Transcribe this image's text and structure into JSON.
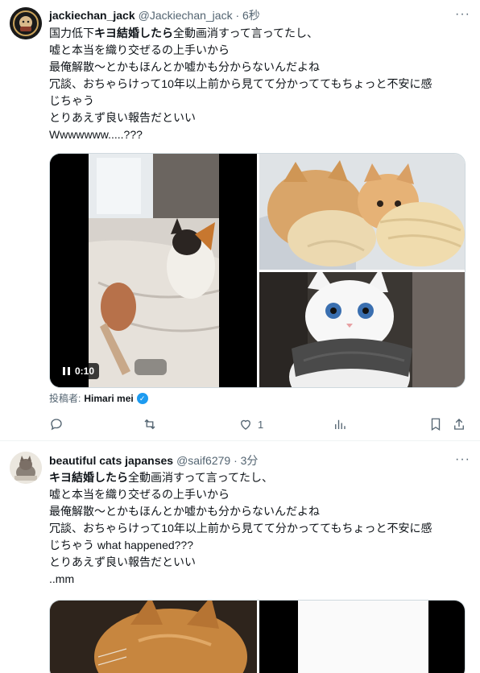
{
  "tweets": [
    {
      "name": "jackiechan_jack",
      "handle": "@Jackiechan_jack · 6秒",
      "more": "···",
      "lines": [
        {
          "pre": "国力低下",
          "bold": "キヨ結婚したら",
          "post": "全動画消すって言ってたし、"
        },
        {
          "pre": "嘘と本当を織り交ぜるの上手いから",
          "bold": "",
          "post": ""
        },
        {
          "pre": "最俺解散〜とかもほんとか嘘かも分からないんだよね",
          "bold": "",
          "post": ""
        },
        {
          "pre": "冗談、おちゃらけって10年以上前から見てて分かっててもちょっと不安に感",
          "bold": "",
          "post": ""
        },
        {
          "pre": "じちゃう",
          "bold": "",
          "post": ""
        },
        {
          "pre": "とりあえず良い報告だといい",
          "bold": "",
          "post": ""
        },
        {
          "pre": "Wwwwwww.....???",
          "bold": "",
          "post": ""
        }
      ],
      "video_time": "0:10",
      "credit_prefix": "投稿者:",
      "credit_user": "Himari mei",
      "verified_mark": "✓",
      "actions": {
        "reply": "",
        "retweet": "",
        "like": "1",
        "views": ""
      }
    },
    {
      "name": "beautiful cats japanses",
      "handle": "@saif6279 · 3分",
      "more": "···",
      "lines": [
        {
          "pre": "",
          "bold": "キヨ結婚したら",
          "post": "全動画消すって言ってたし、"
        },
        {
          "pre": "嘘と本当を織り交ぜるの上手いから",
          "bold": "",
          "post": ""
        },
        {
          "pre": "最俺解散〜とかもほんとか嘘かも分からないんだよね",
          "bold": "",
          "post": ""
        },
        {
          "pre": "冗談、おちゃらけって10年以上前から見てて分かっててもちょっと不安に感",
          "bold": "",
          "post": ""
        },
        {
          "pre": "じちゃう what happened???",
          "bold": "",
          "post": ""
        },
        {
          "pre": "とりあえず良い報告だといい",
          "bold": "",
          "post": ""
        },
        {
          "pre": "..mm",
          "bold": "",
          "post": ""
        }
      ]
    }
  ],
  "colors": {
    "text": "#0f1419",
    "secondary": "#536471",
    "accent": "#1d9bf0",
    "border": "#cfd9de"
  }
}
